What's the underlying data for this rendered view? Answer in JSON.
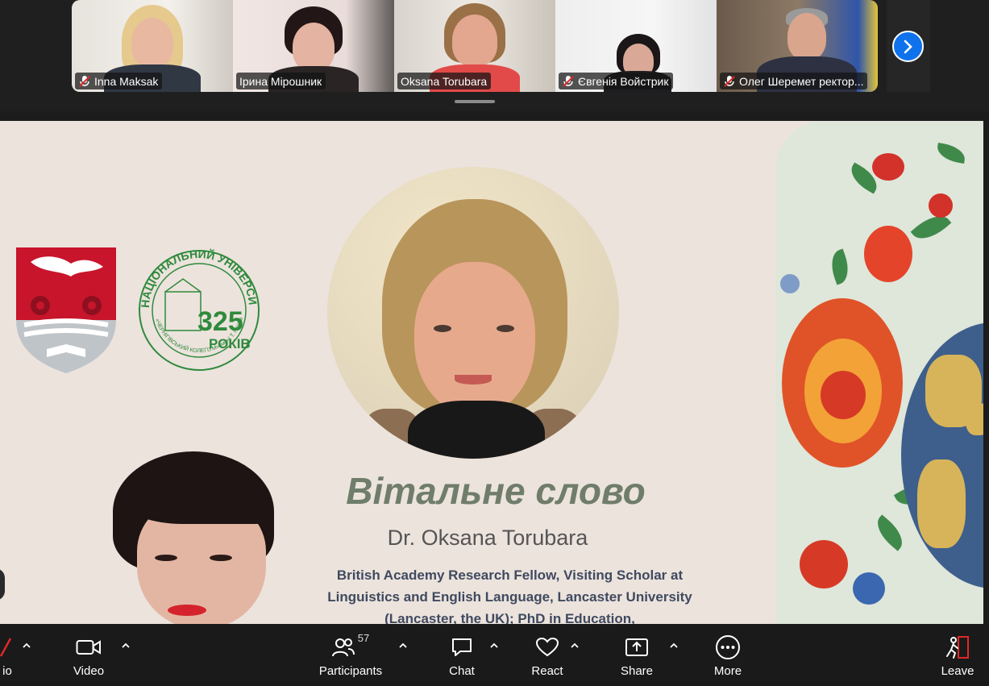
{
  "participants_strip": {
    "tiles": [
      {
        "name": "Inna Maksak",
        "muted": true
      },
      {
        "name": "Ірина Мірошник",
        "muted": false
      },
      {
        "name": "Oksana Torubara",
        "muted": false,
        "active": true
      },
      {
        "name": "Євгенія Войстрик",
        "muted": true
      },
      {
        "name": "Олег Шеремет ректор...",
        "muted": true
      }
    ],
    "next_icon": "chevron-right-icon"
  },
  "slide": {
    "title": "Вітальне слово",
    "speaker": "Dr. Oksana Torubara",
    "description": "British Academy Research Fellow, Visiting Scholar at Linguistics and English Language, Lancaster University (Lancaster, the UK); PhD in Education,",
    "logo_uni_arc": "НАЦІОНАЛЬНИЙ УНІВЕРСИТЕТ",
    "logo_uni_lower": "«ЧЕРНІГІВСЬКИЙ КОЛЕГІУМ» імені Т. Г. Шевченка",
    "logo_uni_number": "325",
    "logo_uni_years": "РОКІВ"
  },
  "toolbar": {
    "audio_label": "io",
    "video_label": "Video",
    "participants_label": "Participants",
    "participants_count": "57",
    "chat_label": "Chat",
    "react_label": "React",
    "share_label": "Share",
    "more_label": "More",
    "leave_label": "Leave"
  },
  "colors": {
    "active_border": "#2ee86f",
    "accent_blue": "#0e72ed",
    "slide_bg": "#ece3dd",
    "title_green": "#6f7d6a",
    "desc_navy": "#3f4a5f"
  }
}
